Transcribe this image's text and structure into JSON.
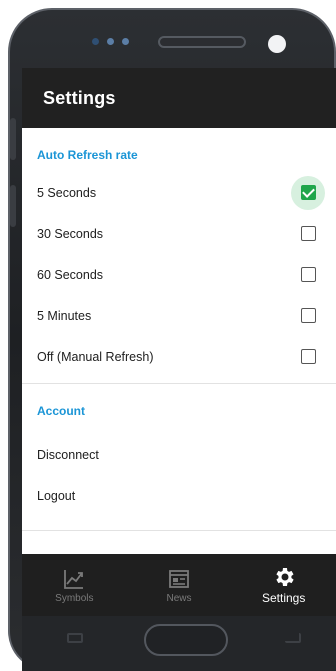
{
  "appbar": {
    "title": "Settings"
  },
  "sections": {
    "refresh": {
      "title": "Auto Refresh rate",
      "options": [
        {
          "label": "5 Seconds",
          "checked": true
        },
        {
          "label": "30 Seconds",
          "checked": false
        },
        {
          "label": "60 Seconds",
          "checked": false
        },
        {
          "label": "5 Minutes",
          "checked": false
        },
        {
          "label": "Off (Manual Refresh)",
          "checked": false
        }
      ]
    },
    "account": {
      "title": "Account",
      "items": [
        {
          "label": "Disconnect"
        },
        {
          "label": "Logout"
        }
      ]
    }
  },
  "bottom_nav": {
    "items": [
      {
        "label": "Symbols",
        "icon": "chart-icon",
        "active": false
      },
      {
        "label": "News",
        "icon": "news-icon",
        "active": false
      },
      {
        "label": "Settings",
        "icon": "gear-icon",
        "active": true
      }
    ]
  },
  "colors": {
    "accent": "#1b95d6",
    "check": "#1fa64b",
    "appbar": "#212121"
  }
}
